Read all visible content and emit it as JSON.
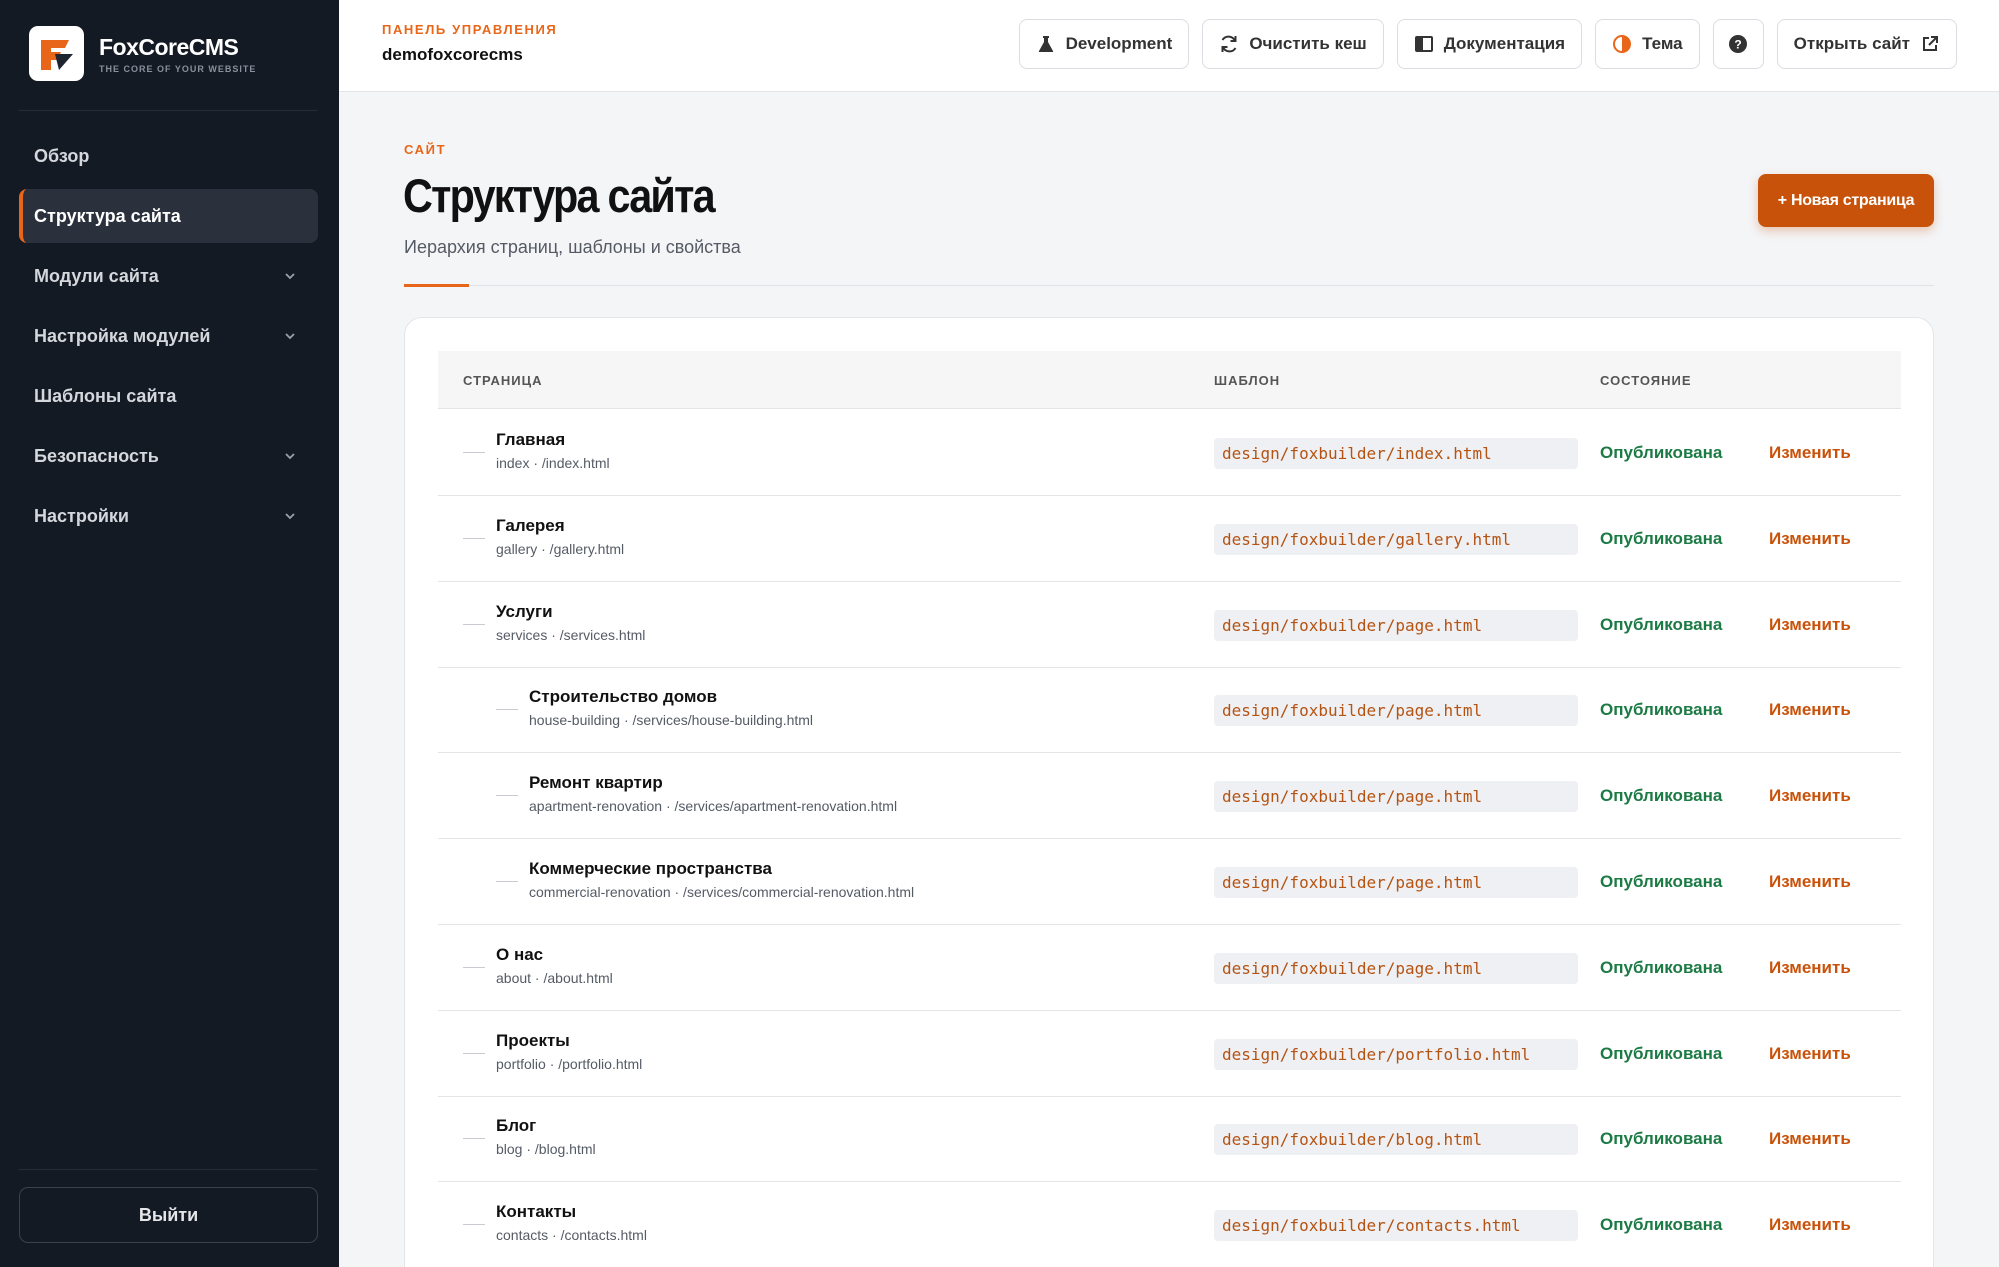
{
  "brand": {
    "name": "FoxCoreCMS",
    "tagline": "THE CORE OF YOUR WEBSITE"
  },
  "sidebar": {
    "items": [
      {
        "label": "Обзор",
        "has_children": false,
        "active": false
      },
      {
        "label": "Структура сайта",
        "has_children": false,
        "active": true
      },
      {
        "label": "Модули сайта",
        "has_children": true,
        "active": false
      },
      {
        "label": "Настройка модулей",
        "has_children": true,
        "active": false
      },
      {
        "label": "Шаблоны сайта",
        "has_children": false,
        "active": false
      },
      {
        "label": "Безопасность",
        "has_children": true,
        "active": false
      },
      {
        "label": "Настройки",
        "has_children": true,
        "active": false
      }
    ],
    "logout_label": "Выйти"
  },
  "header": {
    "crumb_label": "ПАНЕЛЬ УПРАВЛЕНИЯ",
    "site_name": "demofoxcorecms",
    "buttons": {
      "development": "Development",
      "clear_cache": "Очистить кеш",
      "docs": "Документация",
      "theme": "Тема",
      "open_site": "Открыть сайт"
    }
  },
  "main": {
    "section_label": "САЙТ",
    "title": "Структура сайта",
    "subtitle": "Иерархия страниц, шаблоны и свойства",
    "new_page_label": "+ Новая страница",
    "columns": {
      "page": "СТРАНИЦА",
      "template": "ШАБЛОН",
      "status": "СОСТОЯНИЕ"
    },
    "rows": [
      {
        "name": "Главная",
        "meta": "index · /index.html",
        "template": "design/foxbuilder/index.html",
        "status": "Опубликована",
        "action": "Изменить",
        "level": 0
      },
      {
        "name": "Галерея",
        "meta": "gallery · /gallery.html",
        "template": "design/foxbuilder/gallery.html",
        "status": "Опубликована",
        "action": "Изменить",
        "level": 0
      },
      {
        "name": "Услуги",
        "meta": "services · /services.html",
        "template": "design/foxbuilder/page.html",
        "status": "Опубликована",
        "action": "Изменить",
        "level": 0
      },
      {
        "name": "Строительство домов",
        "meta": "house-building · /services/house-building.html",
        "template": "design/foxbuilder/page.html",
        "status": "Опубликована",
        "action": "Изменить",
        "level": 1
      },
      {
        "name": "Ремонт квартир",
        "meta": "apartment-renovation · /services/apartment-renovation.html",
        "template": "design/foxbuilder/page.html",
        "status": "Опубликована",
        "action": "Изменить",
        "level": 1
      },
      {
        "name": "Коммерческие пространства",
        "meta": "commercial-renovation · /services/commercial-renovation.html",
        "template": "design/foxbuilder/page.html",
        "status": "Опубликована",
        "action": "Изменить",
        "level": 1
      },
      {
        "name": "О нас",
        "meta": "about · /about.html",
        "template": "design/foxbuilder/page.html",
        "status": "Опубликована",
        "action": "Изменить",
        "level": 0
      },
      {
        "name": "Проекты",
        "meta": "portfolio · /portfolio.html",
        "template": "design/foxbuilder/portfolio.html",
        "status": "Опубликована",
        "action": "Изменить",
        "level": 0
      },
      {
        "name": "Блог",
        "meta": "blog · /blog.html",
        "template": "design/foxbuilder/blog.html",
        "status": "Опубликована",
        "action": "Изменить",
        "level": 0
      },
      {
        "name": "Контакты",
        "meta": "contacts · /contacts.html",
        "template": "design/foxbuilder/contacts.html",
        "status": "Опубликована",
        "action": "Изменить",
        "level": 0
      }
    ]
  },
  "colors": {
    "accent": "#e8661a",
    "accent_dark": "#c9520b",
    "sidebar_bg": "#141a24",
    "status_green": "#1c7a45"
  }
}
